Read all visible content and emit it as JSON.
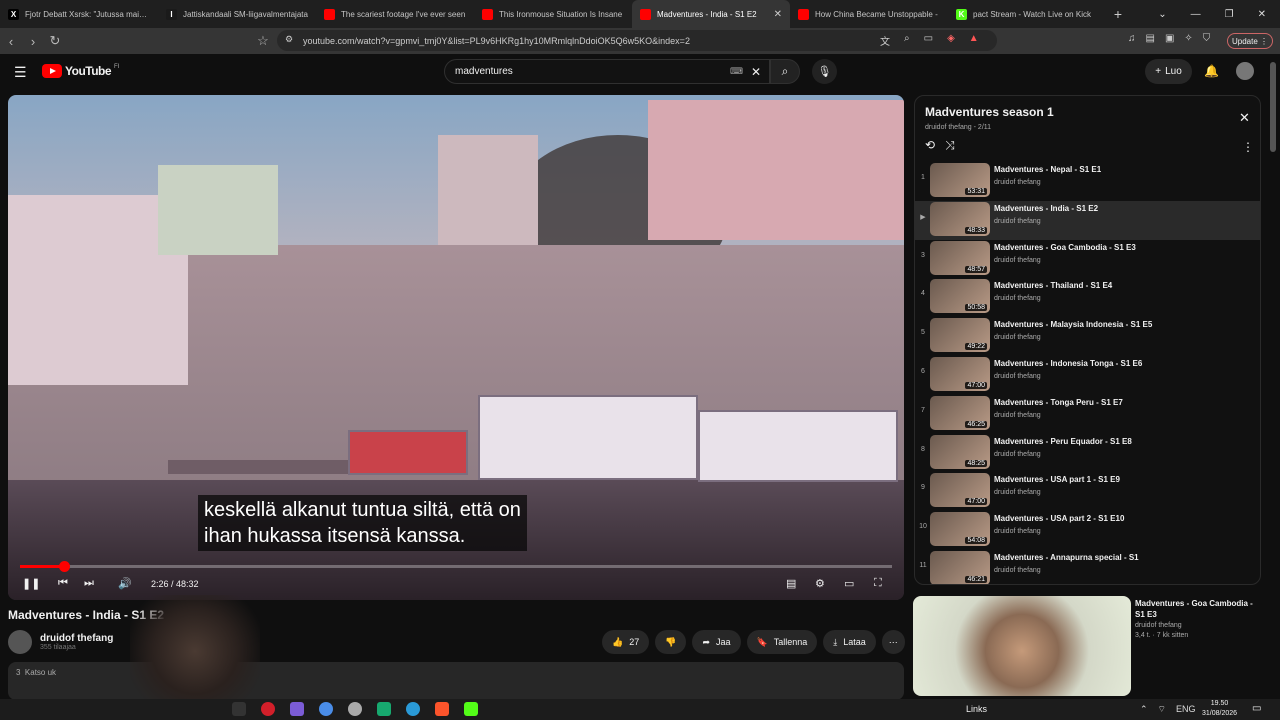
{
  "browser": {
    "tabs": [
      {
        "title": "Fjotr Debatt Xsrsk: \"Jutussa mainitta",
        "fav_bg": "#000000",
        "fav_glyph": "X"
      },
      {
        "title": "Jattiskandaali SM-liigavalmentajata",
        "fav_bg": "#1a1a1a",
        "fav_glyph": "I"
      },
      {
        "title": "The scariest footage I've ever seen",
        "fav_bg": "#ff0000",
        "fav_glyph": ""
      },
      {
        "title": "This Ironmouse Situation Is Insane",
        "fav_bg": "#ff0000",
        "fav_glyph": ""
      },
      {
        "title": "Madventures - India - S1 E2",
        "fav_bg": "#ff0000",
        "fav_glyph": "",
        "active": true
      },
      {
        "title": "How China Became Unstoppable -",
        "fav_bg": "#ff0000",
        "fav_glyph": ""
      },
      {
        "title": "pact Stream - Watch Live on Kick",
        "fav_bg": "#53fc18",
        "fav_glyph": "K"
      }
    ],
    "url": "youtube.com/watch?v=gpmvi_tmj0Y&list=PL9v6HKRg1hy10MRmlqlnDdoiOK5Q6w5KO&index=2",
    "update_label": "Update"
  },
  "yt": {
    "logo_text": "YouTube",
    "logo_country": "FI",
    "search_value": "madventures",
    "create_label": "Luo"
  },
  "player": {
    "subtitle_line1": "keskellä alkanut tuntua siltä, että on",
    "subtitle_line2": "ihan hukassa itsensä kanssa.",
    "time_display": "2:26 / 48:32",
    "progress_fraction": 0.05,
    "playing": true
  },
  "video": {
    "title": "Madventures - India - S1 E2",
    "channel": "druidof thefang",
    "subscribers": "355 tilaajaa",
    "likes": "27",
    "share_label": "Jaa",
    "save_label": "Tallenna",
    "download_label": "Lataa",
    "desc_views": "3",
    "desc_text": "Katso uk"
  },
  "playlist": {
    "title": "Madventures season 1",
    "subtitle": "druidof thefang - 2/11",
    "items": [
      {
        "idx": "1",
        "title": "Madventures - Nepal - S1 E1",
        "channel": "druidof thefang",
        "duration": "53:31"
      },
      {
        "idx": "▶",
        "title": "Madventures - India - S1 E2",
        "channel": "druidof thefang",
        "duration": "48:33",
        "current": true
      },
      {
        "idx": "3",
        "title": "Madventures - Goa Cambodia - S1 E3",
        "channel": "druidof thefang",
        "duration": "48:57"
      },
      {
        "idx": "4",
        "title": "Madventures - Thailand - S1 E4",
        "channel": "druidof thefang",
        "duration": "50:58"
      },
      {
        "idx": "5",
        "title": "Madventures - Malaysia Indonesia - S1 E5",
        "channel": "druidof thefang",
        "duration": "49:22"
      },
      {
        "idx": "6",
        "title": "Madventures - Indonesia Tonga - S1 E6",
        "channel": "druidof thefang",
        "duration": "47:00"
      },
      {
        "idx": "7",
        "title": "Madventures - Tonga Peru - S1 E7",
        "channel": "druidof thefang",
        "duration": "46:25"
      },
      {
        "idx": "8",
        "title": "Madventures - Peru Equador - S1 E8",
        "channel": "druidof thefang",
        "duration": "48:25"
      },
      {
        "idx": "9",
        "title": "Madventures - USA part 1 - S1 E9",
        "channel": "druidof thefang",
        "duration": "47:00"
      },
      {
        "idx": "10",
        "title": "Madventures - USA part 2 - S1 E10",
        "channel": "druidof thefang",
        "duration": "54:08"
      },
      {
        "idx": "11",
        "title": "Madventures - Annapurna special - S1",
        "channel": "druidof thefang",
        "duration": "46:21"
      }
    ]
  },
  "recommended": {
    "title": "Madventures - Goa Cambodia - S1 E3",
    "channel": "druidof thefang",
    "meta": "3,4 t. · 7 kk sitten"
  },
  "taskbar": {
    "links_label": "Links",
    "lang": "ENG",
    "time": "19.50",
    "date": "31/08/2026"
  }
}
